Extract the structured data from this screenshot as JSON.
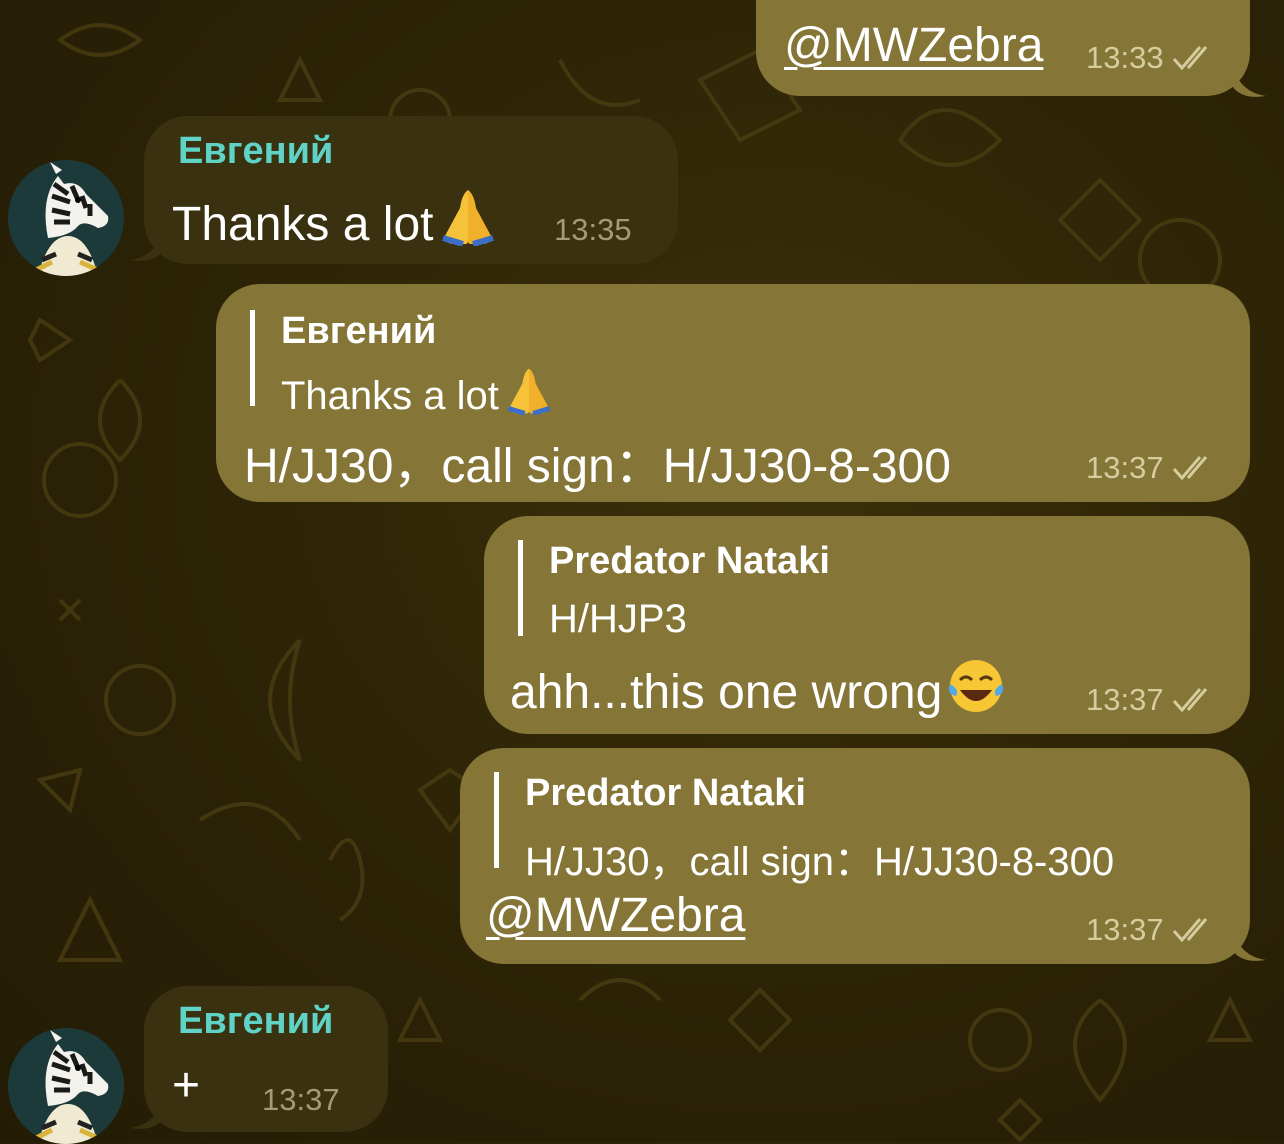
{
  "messages": [
    {
      "text": "@MWZebra",
      "time": "13:33"
    },
    {
      "sender": "Евгений",
      "text": "Thanks a lot",
      "time": "13:35"
    },
    {
      "quote_name": "Евгений",
      "quote_text": "Thanks a lot",
      "text": "H/JJ30，call sign：H/JJ30-8-300",
      "time": "13:37"
    },
    {
      "quote_name": "Predator Nataki",
      "quote_text": "H/HJP3",
      "text": "ahh...this one wrong",
      "time": "13:37"
    },
    {
      "quote_name": "Predator Nataki",
      "quote_text": "H/JJ30，call sign：H/JJ30-8-300",
      "text": "@MWZebra",
      "time": "13:37"
    },
    {
      "sender": "Евгений",
      "text": "+",
      "time": "13:37"
    }
  ],
  "icons": {
    "read_status": "double-check-icon",
    "pray": "folded-hands-emoji",
    "laugh": "tears-of-joy-emoji",
    "avatar": "zebra-avatar"
  },
  "colors": {
    "outgoing_bubble": "#857536",
    "incoming_bubble": "#39310f",
    "sender_name": "#5ed3c6",
    "background": "#2e2507"
  }
}
